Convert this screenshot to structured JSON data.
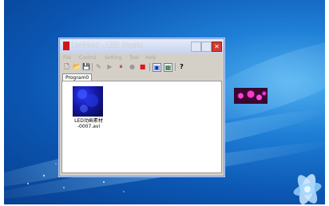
{
  "window": {
    "title": "Untitled - LED Studio",
    "close_glyph": "✕"
  },
  "menubar": {
    "items": [
      "File",
      "Control",
      "Setting",
      "Tool",
      "Help"
    ]
  },
  "toolbar": {
    "buttons": [
      {
        "name": "new-icon",
        "glyph": "🗋"
      },
      {
        "name": "open-folder-icon",
        "glyph": "📂"
      },
      {
        "name": "save-icon",
        "glyph": "💾"
      },
      {
        "name": "edit-icon",
        "glyph": "✎"
      },
      {
        "name": "play-icon",
        "glyph": "▶"
      },
      {
        "name": "pause-icon",
        "glyph": "⏸"
      },
      {
        "name": "record-icon",
        "glyph": "●"
      },
      {
        "name": "stop-icon",
        "glyph": "■"
      },
      {
        "name": "screen-icon",
        "glyph": "▣"
      },
      {
        "name": "layout-icon",
        "glyph": "▦"
      },
      {
        "name": "help-icon",
        "glyph": "?"
      }
    ]
  },
  "tabs": [
    {
      "label": "Program0"
    }
  ],
  "files": [
    {
      "name": "LED动画素材\n-0007.avi"
    }
  ],
  "colors": {
    "close_button": "#d13b2f",
    "record_red": "#d01818",
    "thumb_blue": "#1418a8",
    "preview_magenta": "#ff3fd0"
  }
}
